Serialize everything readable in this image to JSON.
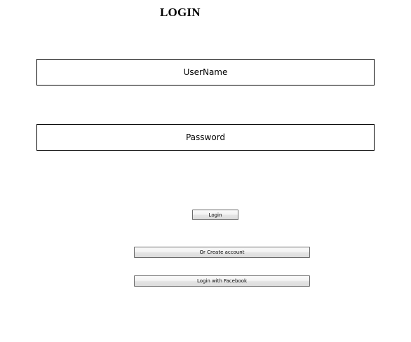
{
  "page": {
    "title": "LOGIN"
  },
  "form": {
    "username_placeholder": "UserName",
    "password_placeholder": "Password",
    "login_label": "Login",
    "create_account_label": "Or Create account",
    "facebook_login_label": "Login with Facebook"
  }
}
